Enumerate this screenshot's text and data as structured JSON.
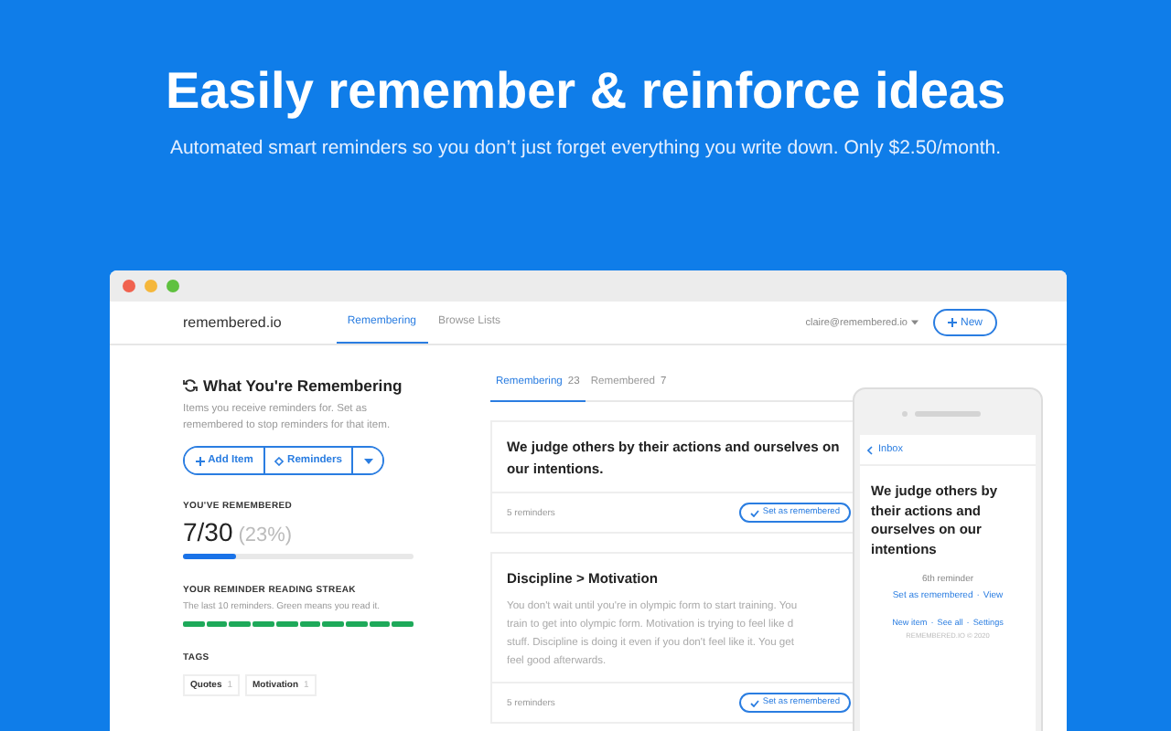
{
  "hero": {
    "title": "Easily remember & reinforce ideas",
    "subtitle": "Automated smart reminders so you don’t just forget everything you write down. Only $2.50/month."
  },
  "window": {
    "brand": "remembered.io",
    "nav_tabs": [
      {
        "label": "Remembering",
        "selected": true
      },
      {
        "label": "Browse Lists",
        "selected": false
      }
    ],
    "account": "claire@remembered.io",
    "new_button": "New"
  },
  "sidebar": {
    "heading": "What You're Remembering",
    "description": "Items you receive reminders for. Set as remembered to stop reminders for that item.",
    "buttons": [
      {
        "kind": "add",
        "label": "Add Item"
      },
      {
        "kind": "reminders",
        "label": "Reminders"
      },
      {
        "kind": "dropdown"
      }
    ],
    "progress": {
      "label": "YOU'VE REMEMBERED",
      "count": "7/30",
      "percent": "(23%)",
      "level": 0.23
    },
    "streak": {
      "label": "YOUR REMINDER READING STREAK",
      "description": "The last 10 reminders. Green means you read it.",
      "days": [
        {
          "read": true
        },
        {
          "read": true
        },
        {
          "read": true
        },
        {
          "read": true
        },
        {
          "read": true
        },
        {
          "read": true
        },
        {
          "read": true
        },
        {
          "read": true
        },
        {
          "read": true
        },
        {
          "read": true
        }
      ]
    },
    "tags": {
      "label": "TAGS",
      "items": [
        {
          "name": "Quotes",
          "count": "1"
        },
        {
          "name": "Motivation",
          "count": "1"
        }
      ]
    }
  },
  "list_tabs": [
    {
      "label": "Remembering",
      "count": "23",
      "selected": true
    },
    {
      "label": "Remembered",
      "count": "7",
      "selected": false
    }
  ],
  "cards": [
    {
      "title_lines": [
        "We judge others by their actions and ourselves on",
        "our intentions."
      ],
      "reminders": "5 reminders",
      "action": "Set as remembered"
    },
    {
      "title_lines": [
        "Discipline > Motivation"
      ],
      "body_lines": [
        "You don't wait until you're in olympic form to start training. You",
        "train to get into olympic form. Motivation is trying to feel like d",
        "stuff. Discipline is doing it even if you don't feel like it. You get",
        "feel good afterwards."
      ],
      "reminders": "5 reminders",
      "action": "Set as remembered"
    }
  ],
  "phone": {
    "back": "Inbox",
    "title": "We judge others by their actions and ourselves on our intentions",
    "reminder": "6th reminder",
    "actions": [
      "Set as remembered",
      "View"
    ],
    "links": [
      "New item",
      "See all",
      "Settings"
    ],
    "separator": "·",
    "footer": "REMEMBERED.IO © 2020"
  }
}
